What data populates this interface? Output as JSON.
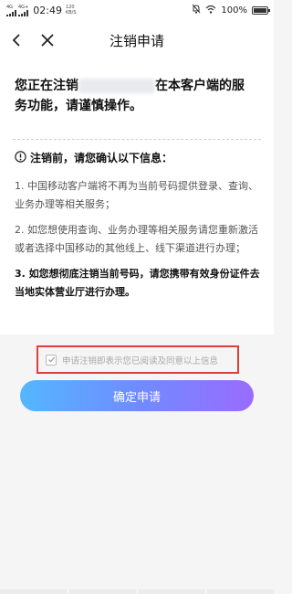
{
  "status_bar": {
    "signal_1_label": "4G",
    "signal_2_label": "4G+",
    "time": "02:49",
    "net_speed_value": "120",
    "net_speed_unit": "KB/S",
    "battery": "100%",
    "battery_level": 1.0
  },
  "nav": {
    "title": "注销申请",
    "back_icon": "chevron-left-icon",
    "close_icon": "close-icon"
  },
  "warning": {
    "prefix": "您正在注销",
    "suffix": "在本客户端的服 务功能，请谨慎操作。"
  },
  "info": {
    "title": "注销前，请您确认以下信息：",
    "items": [
      "1. 中国移动客户端将不再为当前号码提供登录、查询、业务办理等相关服务；",
      "2. 如您想使用查询、业务办理等相关服务请您重新激活或者选择中国移动的其他线上、线下渠道进行办理；",
      "3. 如您想彻底注销当前号码，请您携带有效身份证件去当地实体营业厅进行办理。"
    ]
  },
  "agreement": {
    "text": "申请注销即表示您已阅读及同意以上信息",
    "checked": true
  },
  "submit": {
    "label": "确定申请"
  },
  "colors": {
    "highlight_border": "#d9423a",
    "button_gradient_start": "#54b7ff",
    "button_gradient_end": "#9a6bff"
  }
}
